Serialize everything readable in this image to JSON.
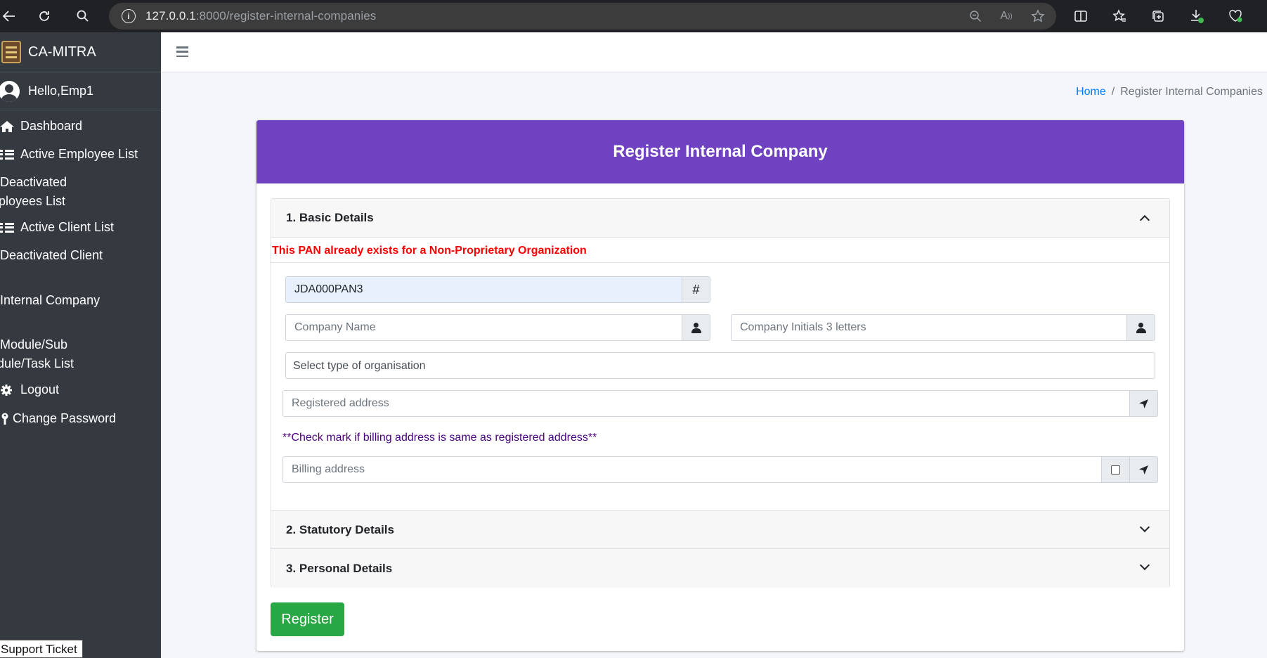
{
  "browser": {
    "url_host": "127.0.0.1",
    "url_rest": ":8000/register-internal-companies"
  },
  "sidebar": {
    "brand": "CA-MITRA",
    "greeting": "Hello,Emp1",
    "items": [
      {
        "label": "Dashboard",
        "icon": "home-icon"
      },
      {
        "label": "Active Employee List",
        "icon": "list-icon"
      },
      {
        "label": "Deactivated Employees List",
        "icon": "list-icon"
      },
      {
        "label": "Active Client List",
        "icon": "list-icon"
      },
      {
        "label": "Deactivated Client List",
        "icon": "list-icon"
      },
      {
        "label": "Internal Company List",
        "icon": "list-icon"
      },
      {
        "label": "Module/Sub Module/Task List",
        "icon": "list-icon"
      },
      {
        "label": "Logout",
        "icon": "gear-icon"
      },
      {
        "label": "Change Password",
        "icon": "key-icon"
      }
    ],
    "support": "Support Ticket"
  },
  "breadcrumb": {
    "home": "Home",
    "separator": "/",
    "current": "Register Internal Companies"
  },
  "card": {
    "title": "Register Internal Company",
    "header_color": "#6f42c1"
  },
  "sections": {
    "basic": "1. Basic Details",
    "statutory": "2. Statutory Details",
    "personal": "3. Personal Details"
  },
  "form": {
    "error": "This PAN already exists for a Non-Proprietary Organization",
    "pan_value": "JDA000PAN3",
    "pan_addon": "#",
    "company_name_placeholder": "Company Name",
    "initials_placeholder": "Company Initials 3 letters",
    "org_type_selected": "Select type of organisation",
    "registered_address_placeholder": "Registered address",
    "billing_note": "**Check mark if billing address is same as registered address**",
    "billing_address_placeholder": "Billing address"
  },
  "register_label": "Register",
  "colors": {
    "sidebar": "#343a40",
    "accent": "#6f42c1",
    "error": "#ff0000",
    "success": "#28a745",
    "link": "#007bff"
  }
}
